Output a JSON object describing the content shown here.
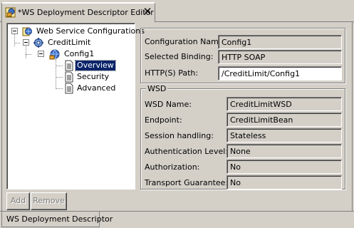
{
  "editor": {
    "tab_title": "*WS Deployment Descriptor Editor",
    "close_glyph": "✕"
  },
  "tree": {
    "root": "Web Service Configurations",
    "service": "CreditLimit",
    "config": "Config1",
    "pages": [
      "Overview",
      "Security",
      "Advanced"
    ],
    "selected": "Overview"
  },
  "buttons": {
    "add": "Add",
    "remove": "Remove"
  },
  "config": {
    "name_label": "Configuration Name:",
    "name_value": "Config1",
    "binding_label": "Selected Binding:",
    "binding_value": "HTTP SOAP",
    "path_label": "HTTP(S) Path:",
    "path_value": "/CreditLimit/Config1"
  },
  "wsd": {
    "legend": "WSD",
    "fields": [
      {
        "label": "WSD Name:",
        "value": "CreditLimitWSD"
      },
      {
        "label": "Endpoint:",
        "value": "CreditLimitBean"
      },
      {
        "label": "Session handling:",
        "value": "Stateless"
      },
      {
        "label": "Authentication Level:",
        "value": "None"
      },
      {
        "label": "Authorization:",
        "value": "No"
      },
      {
        "label": "Transport Guarantee:",
        "value": "No"
      }
    ]
  },
  "bottom_tab": {
    "label": "WS Deployment Descriptor"
  },
  "icons": {
    "tab": "ws-editor-icon",
    "root": "web-service-configurations-icon",
    "service": "gear-service-icon",
    "config": "config-globe-icon",
    "page": "document-page-icon"
  }
}
